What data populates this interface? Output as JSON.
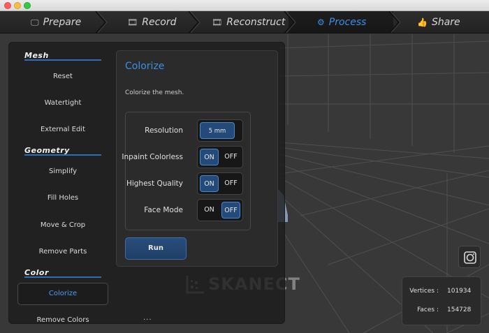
{
  "steps": [
    {
      "label": "Prepare",
      "icon": "monitor-icon"
    },
    {
      "label": "Record",
      "icon": "film-icon"
    },
    {
      "label": "Reconstruct",
      "icon": "film-icon"
    },
    {
      "label": "Process",
      "icon": "gears-icon",
      "active": true
    },
    {
      "label": "Share",
      "icon": "thumbs-up-icon"
    }
  ],
  "nav": {
    "mesh": {
      "title": "Mesh",
      "items": [
        "Reset",
        "Watertight",
        "External Edit"
      ]
    },
    "geometry": {
      "title": "Geometry",
      "items": [
        "Simplify",
        "Fill Holes",
        "Move & Crop",
        "Remove Parts"
      ]
    },
    "color": {
      "title": "Color",
      "items": [
        "Colorize",
        "Remove Colors"
      ],
      "selected": "Colorize"
    }
  },
  "panel": {
    "title": "Colorize",
    "description": "Colorize the mesh.",
    "options": [
      {
        "label": "Resolution",
        "value": "5 mm"
      },
      {
        "label": "Inpaint Colorless",
        "on": "ON",
        "off": "OFF",
        "selected": "on"
      },
      {
        "label": "Highest Quality",
        "on": "ON",
        "off": "OFF",
        "selected": "on"
      },
      {
        "label": "Face Mode",
        "on": "ON",
        "off": "OFF",
        "selected": "off"
      }
    ],
    "run_label": "Run"
  },
  "more_indicator": "···",
  "logo_text": "SKANECT",
  "stats": {
    "vertices_label": "Vertices :",
    "vertices_value": "101934",
    "faces_label": "Faces :",
    "faces_value": "154728"
  },
  "colors": {
    "accent": "#3a8ee6",
    "button": "#234a78",
    "panel": "#2b2b2b"
  }
}
